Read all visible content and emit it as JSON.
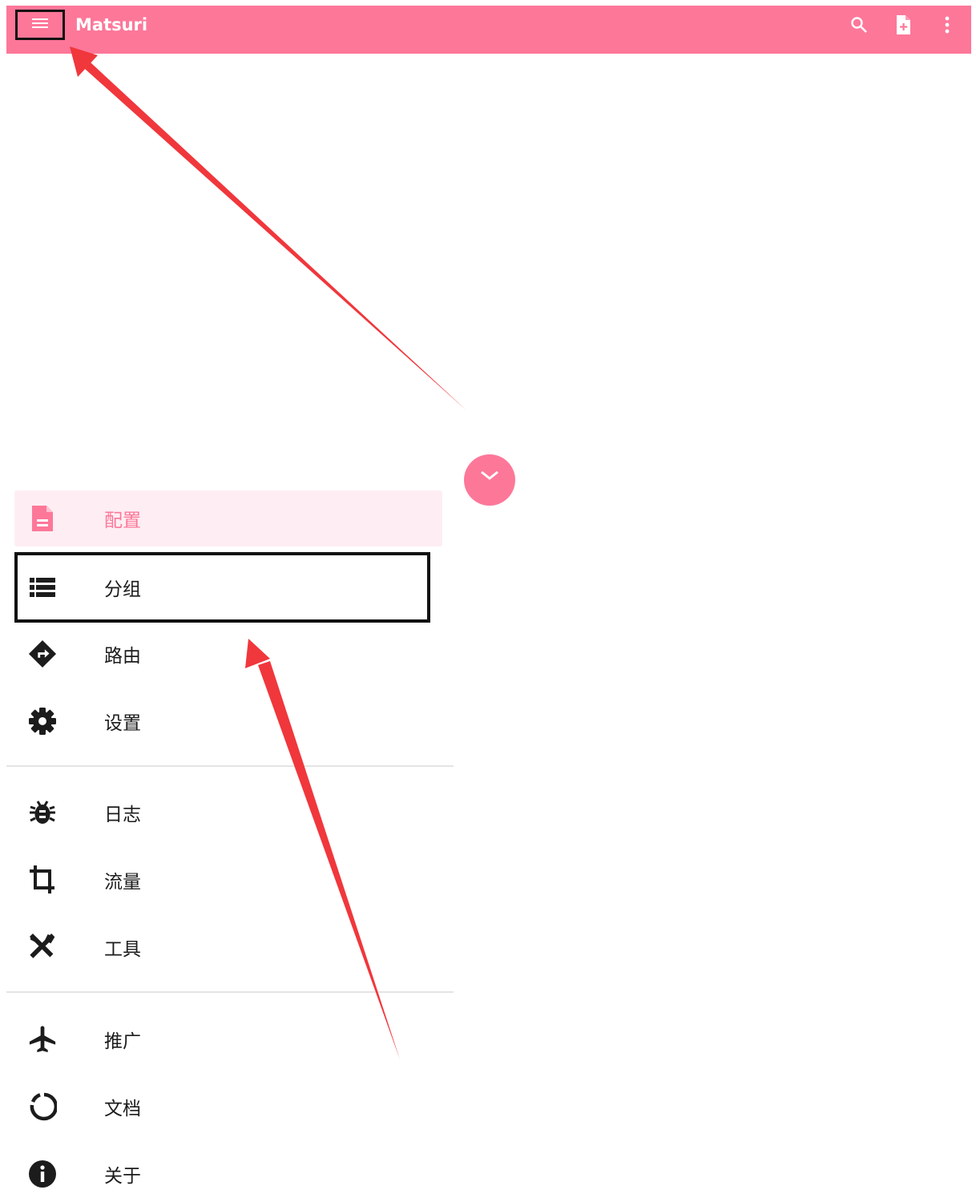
{
  "app": {
    "title": "Matsuri"
  },
  "toolbar": {
    "left_icon": "menu-icon",
    "actions": [
      "search-icon",
      "new-file-icon",
      "more-vert-icon"
    ],
    "color": "#fd7799"
  },
  "drawer": {
    "active_item": "配置",
    "items": [
      {
        "label": "配置",
        "icon": "file-icon"
      },
      {
        "label": "分组",
        "icon": "list-icon"
      },
      {
        "label": "路由",
        "icon": "directions-icon"
      },
      {
        "label": "设置",
        "icon": "gear-icon"
      },
      {
        "label": "日志",
        "icon": "bug-icon"
      },
      {
        "label": "流量",
        "icon": "crop-icon"
      },
      {
        "label": "工具",
        "icon": "tools-icon"
      },
      {
        "label": "推广",
        "icon": "airplane-icon"
      },
      {
        "label": "文档",
        "icon": "circle-outline-icon"
      },
      {
        "label": "关于",
        "icon": "info-icon"
      }
    ]
  },
  "annotations": {
    "arrow_color": "#f0373c",
    "box_color": "#111111"
  }
}
